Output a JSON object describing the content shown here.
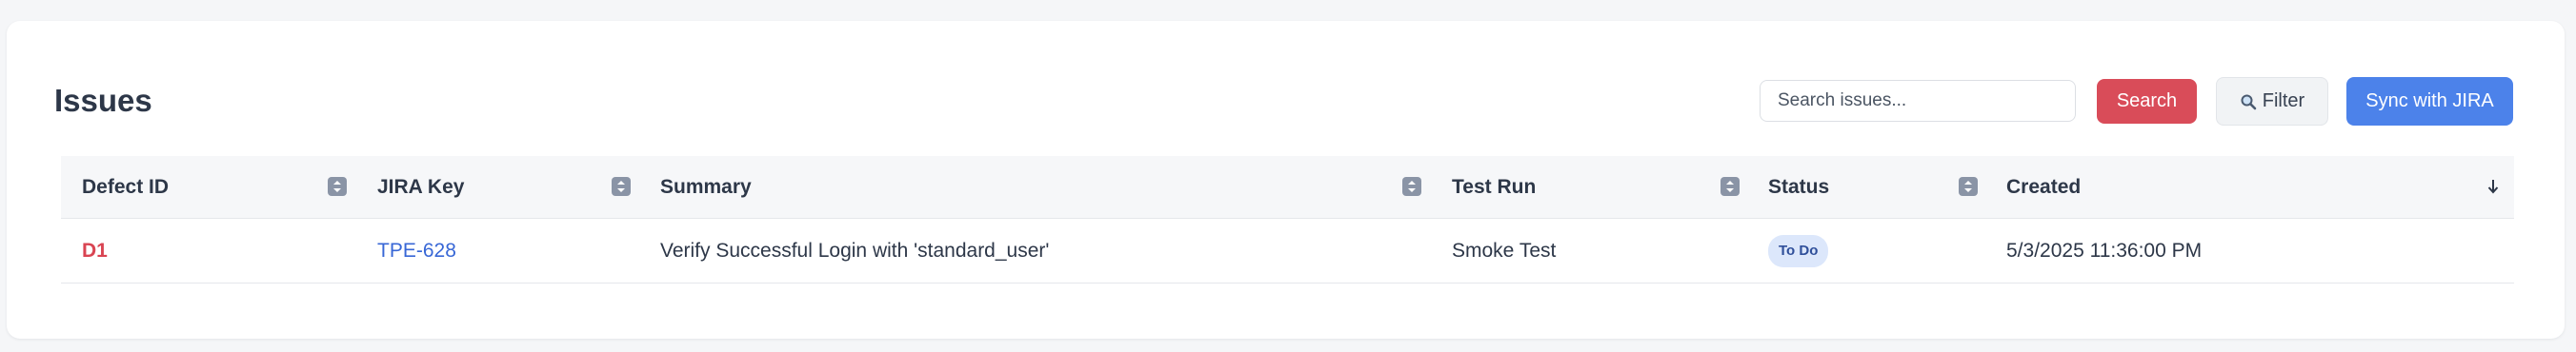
{
  "header": {
    "title": "Issues"
  },
  "toolbar": {
    "search_placeholder": "Search issues...",
    "search_label": "Search",
    "filter_label": "Filter",
    "sync_label": "Sync with JIRA"
  },
  "table": {
    "columns": [
      {
        "label": "Defect ID",
        "sort_icon": "sort-toggle-icon"
      },
      {
        "label": "JIRA Key",
        "sort_icon": "sort-toggle-icon"
      },
      {
        "label": "Summary",
        "sort_icon": "sort-toggle-icon"
      },
      {
        "label": "Test Run",
        "sort_icon": "sort-toggle-icon"
      },
      {
        "label": "Status",
        "sort_icon": "sort-toggle-icon"
      },
      {
        "label": "Created",
        "sort_icon": "sort-descending-icon"
      }
    ],
    "rows": [
      {
        "defect_id": "D1",
        "jira_key": "TPE-628",
        "summary": "Verify Successful Login with 'standard_user'",
        "test_run": "Smoke Test",
        "status": "To Do",
        "created": "5/3/2025 11:36:00 PM"
      }
    ]
  },
  "colors": {
    "danger": "#d94c59",
    "primary": "#4c82ea",
    "link": "#3867d6",
    "badge_bg": "#dce7fb"
  }
}
